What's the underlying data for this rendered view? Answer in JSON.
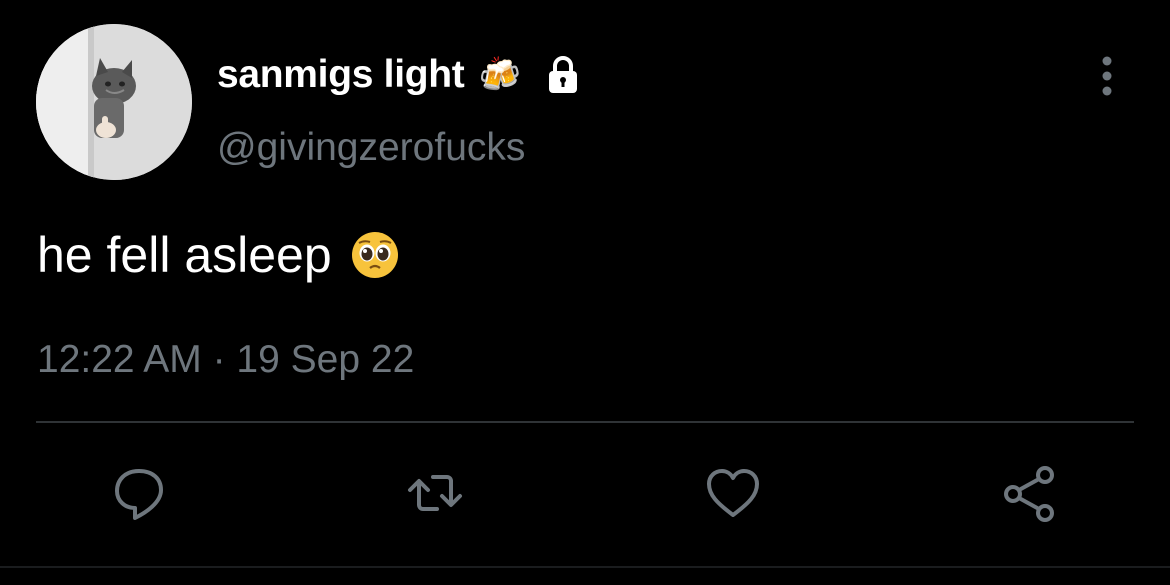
{
  "tweet": {
    "author": {
      "display_name": "sanmigs light",
      "name_emoji": "🍻",
      "handle": "@givingzerofucks",
      "protected_icon": "lock-icon",
      "avatar_icon": "cat-avatar"
    },
    "text": "he fell asleep",
    "text_emoji": "pleading-face-emoji",
    "timestamp": "12:22 AM · 19 Sep 22"
  },
  "actions": [
    {
      "name": "reply",
      "icon": "reply-icon"
    },
    {
      "name": "retweet",
      "icon": "retweet-icon"
    },
    {
      "name": "like",
      "icon": "heart-icon"
    },
    {
      "name": "share",
      "icon": "share-icon"
    }
  ],
  "menu": {
    "icon": "more-vertical-icon"
  },
  "colors": {
    "background": "#000000",
    "primary_text": "#ffffff",
    "secondary_text": "#6e767d",
    "divider": "#2f3336",
    "icon": "#6e767d"
  }
}
